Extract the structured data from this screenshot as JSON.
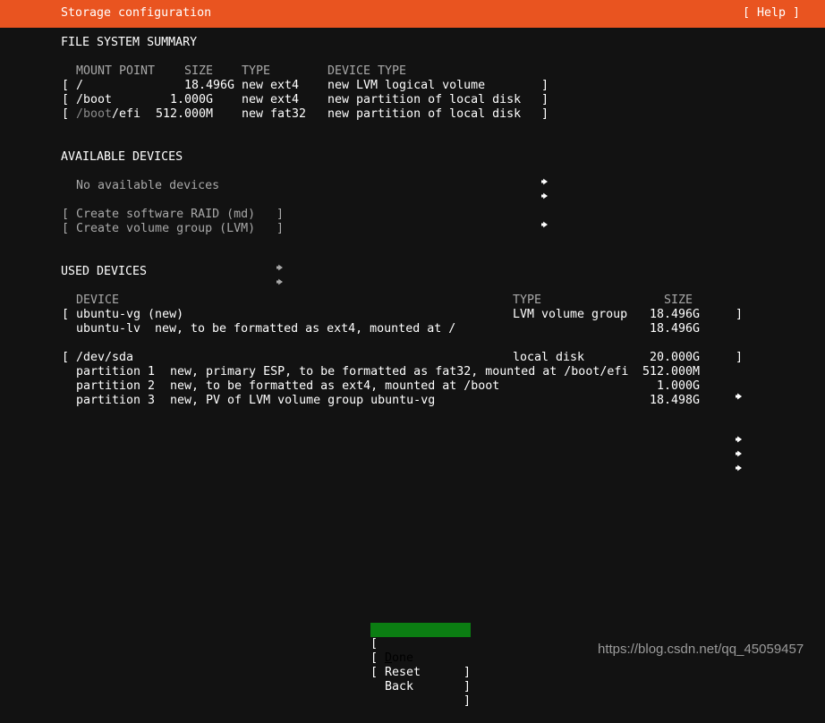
{
  "header": {
    "title": "Storage configuration",
    "help_label": "[ Help ]",
    "bg_color": "#e95420",
    "fg_color": "#ffffff"
  },
  "theme": {
    "background": "#121212",
    "foreground": "#ffffff",
    "dim": "#a8a8a8",
    "selected_bg": "#0b7d12",
    "selected_fg": "#000000"
  },
  "filesystem_summary": {
    "section_title": "FILE SYSTEM SUMMARY",
    "columns": {
      "mount_point": "MOUNT POINT",
      "size": "SIZE",
      "type": "TYPE",
      "device_type": "DEVICE TYPE"
    },
    "rows": [
      {
        "bracket_open": "[",
        "bracket_close": "]",
        "mount_prefix": "",
        "mount_point": "/",
        "size": "18.496G",
        "type": "new ext4",
        "device_type": "new LVM logical volume",
        "arrow": "right-triangle-icon"
      },
      {
        "bracket_open": "[",
        "bracket_close": "]",
        "mount_prefix": "",
        "mount_point": "/boot",
        "size": "1.000G",
        "type": "new ext4",
        "device_type": "new partition of local disk",
        "arrow": "right-triangle-icon"
      },
      {
        "bracket_open": "[",
        "bracket_close": "]",
        "mount_prefix": "/boot",
        "mount_point": "/efi",
        "size": "512.000M",
        "type": "new fat32",
        "device_type": "new partition of local disk",
        "arrow": "right-triangle-icon"
      }
    ]
  },
  "available_devices": {
    "section_title": "AVAILABLE DEVICES",
    "empty_message": "No available devices",
    "actions": [
      {
        "bracket_open": "[",
        "label": "Create software RAID (md)",
        "arrow": "right-triangle-icon",
        "bracket_close": "]"
      },
      {
        "bracket_open": "[",
        "label": "Create volume group (LVM)",
        "arrow": "right-triangle-icon",
        "bracket_close": "]"
      }
    ]
  },
  "used_devices": {
    "section_title": "USED DEVICES",
    "columns": {
      "device": "DEVICE",
      "type": "TYPE",
      "size": "SIZE"
    },
    "groups": [
      {
        "header": {
          "bracket_open": "[",
          "device": "ubuntu-vg (new)",
          "type": "LVM volume group",
          "size": "18.496G",
          "arrow": "right-triangle-icon",
          "bracket_close": "]"
        },
        "children": [
          {
            "device": "ubuntu-lv",
            "detail": "new, to be formatted as ext4, mounted at /",
            "type": "",
            "size": "18.496G",
            "arrow": "right-triangle-icon"
          }
        ]
      },
      {
        "header": {
          "bracket_open": "[",
          "device": "/dev/sda",
          "type": "local disk",
          "size": "20.000G",
          "arrow": "right-triangle-icon",
          "bracket_close": "]"
        },
        "children": [
          {
            "device": "partition 1",
            "detail": "new, primary ESP, to be formatted as fat32, mounted at /boot/efi",
            "type": "",
            "size": "512.000M",
            "arrow": "right-triangle-icon"
          },
          {
            "device": "partition 2",
            "detail": "new, to be formatted as ext4, mounted at /boot",
            "type": "",
            "size": "1.000G",
            "arrow": "right-triangle-icon"
          },
          {
            "device": "partition 3",
            "detail": "new, PV of LVM volume group ubuntu-vg",
            "type": "",
            "size": "18.498G",
            "arrow": "right-triangle-icon"
          }
        ]
      }
    ]
  },
  "buttons": [
    {
      "label": "Done",
      "accel": "D",
      "rest": "one",
      "selected": true,
      "bracket_open": "[",
      "bracket_close": "]"
    },
    {
      "label": "Reset",
      "accel": "",
      "rest": "Reset",
      "selected": false,
      "bracket_open": "[",
      "bracket_close": "]"
    },
    {
      "label": "Back",
      "accel": "",
      "rest": "Back",
      "selected": false,
      "bracket_open": "[",
      "bracket_close": "]"
    }
  ],
  "watermark": {
    "text": "https://blog.csdn.net/qq_45059457"
  }
}
